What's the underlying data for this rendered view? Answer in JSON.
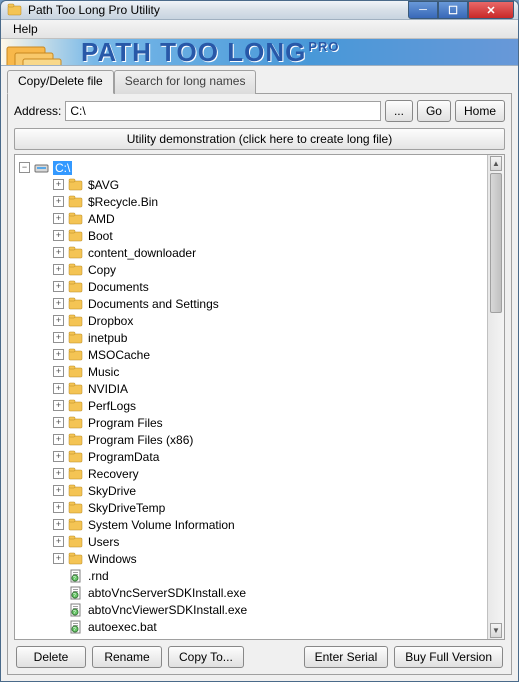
{
  "window": {
    "title": "Path Too Long Pro Utility"
  },
  "menubar": {
    "help": "Help"
  },
  "banner": {
    "text": "PATH TOO LONG",
    "suffix": "PRO"
  },
  "tabs": {
    "copy_delete": "Copy/Delete file",
    "search": "Search for long names"
  },
  "address": {
    "label": "Address:",
    "value": "C:\\",
    "browse": "...",
    "go": "Go",
    "home": "Home"
  },
  "demo_bar": "Utility demonstration (click here to create long file)",
  "tree": {
    "root": {
      "label": "C:\\",
      "type": "drive",
      "expanded": true,
      "selected": true
    },
    "children": [
      {
        "label": "$AVG",
        "type": "folder"
      },
      {
        "label": "$Recycle.Bin",
        "type": "folder"
      },
      {
        "label": "AMD",
        "type": "folder"
      },
      {
        "label": "Boot",
        "type": "folder"
      },
      {
        "label": "content_downloader",
        "type": "folder"
      },
      {
        "label": "Copy",
        "type": "folder"
      },
      {
        "label": "Documents",
        "type": "folder"
      },
      {
        "label": "Documents and Settings",
        "type": "folder"
      },
      {
        "label": "Dropbox",
        "type": "folder"
      },
      {
        "label": "inetpub",
        "type": "folder"
      },
      {
        "label": "MSOCache",
        "type": "folder"
      },
      {
        "label": "Music",
        "type": "folder"
      },
      {
        "label": "NVIDIA",
        "type": "folder"
      },
      {
        "label": "PerfLogs",
        "type": "folder"
      },
      {
        "label": "Program Files",
        "type": "folder"
      },
      {
        "label": "Program Files (x86)",
        "type": "folder"
      },
      {
        "label": "ProgramData",
        "type": "folder"
      },
      {
        "label": "Recovery",
        "type": "folder"
      },
      {
        "label": "SkyDrive",
        "type": "folder"
      },
      {
        "label": "SkyDriveTemp",
        "type": "folder"
      },
      {
        "label": "System Volume Information",
        "type": "folder"
      },
      {
        "label": "Users",
        "type": "folder"
      },
      {
        "label": "Windows",
        "type": "folder"
      },
      {
        "label": ".rnd",
        "type": "file"
      },
      {
        "label": "abtoVncServerSDKInstall.exe",
        "type": "file"
      },
      {
        "label": "abtoVncViewerSDKInstall.exe",
        "type": "file"
      },
      {
        "label": "autoexec.bat",
        "type": "file"
      }
    ]
  },
  "buttons": {
    "delete": "Delete",
    "rename": "Rename",
    "copy_to": "Copy To...",
    "enter_serial": "Enter Serial",
    "buy_full": "Buy Full Version"
  }
}
